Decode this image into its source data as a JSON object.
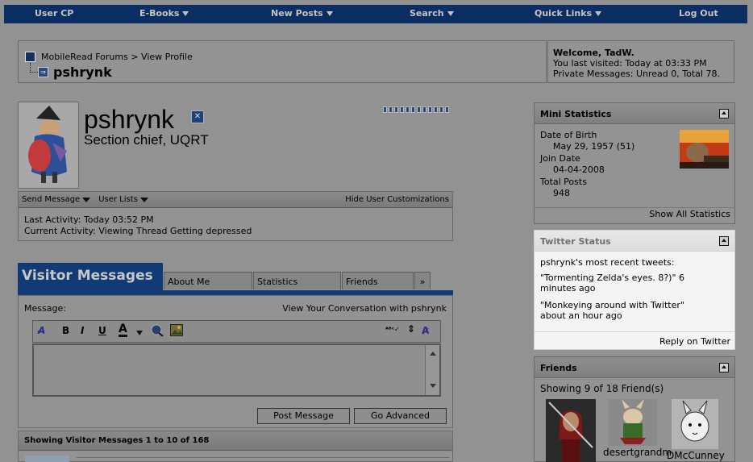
{
  "nav": {
    "items": [
      {
        "label": "User CP",
        "dropdown": false
      },
      {
        "label": "E-Books",
        "dropdown": true
      },
      {
        "label": "New Posts",
        "dropdown": true
      },
      {
        "label": "Search",
        "dropdown": true
      },
      {
        "label": "Quick Links",
        "dropdown": true
      },
      {
        "label": "Log Out",
        "dropdown": false
      }
    ]
  },
  "breadcrumb": {
    "site": "MobileRead Forums",
    "separator": ">",
    "current": "View Profile",
    "page_title": "pshrynk"
  },
  "welcome": {
    "greeting": "Welcome, TadW.",
    "last_visited": "You last visited: Today at 03:33 PM",
    "private_messages": "Private Messages: Unread 0, Total 78."
  },
  "profile": {
    "username": "pshrynk",
    "user_title": "Section chief, UQRT",
    "reputation_pips": 12
  },
  "activity_bar": {
    "send_message": "Send Message",
    "user_lists": "User Lists",
    "hide_customizations": "Hide User Customizations"
  },
  "activity": {
    "last_activity_label": "Last Activity:",
    "last_activity_value": "Today 03:52 PM",
    "current_activity_label": "Current Activity:",
    "current_activity_value": "Viewing Thread Getting depressed"
  },
  "tabs": {
    "active": "Visitor Messages",
    "items": [
      "About Me",
      "Statistics",
      "Friends",
      "»"
    ]
  },
  "message_form": {
    "label": "Message:",
    "conversation_link": "View Your Conversation with pshrynk",
    "post_button": "Post Message",
    "advanced_button": "Go Advanced"
  },
  "visitor_messages_bar": "Showing Visitor Messages 1 to 10 of 168",
  "mini_stats": {
    "title": "Mini Statistics",
    "dob_label": "Date of Birth",
    "dob_value": "May 29, 1957 (51)",
    "join_label": "Join Date",
    "join_value": "04-04-2008",
    "posts_label": "Total Posts",
    "posts_value": "948",
    "show_all": "Show All Statistics"
  },
  "twitter": {
    "title": "Twitter Status",
    "intro": "pshrynk's most recent tweets:",
    "tweets": [
      {
        "text": "\"Tormenting Zelda's eyes. 8?)\"",
        "time_a": "6",
        "time_b": "minutes ago"
      },
      {
        "text": "\"Monkeying around with Twitter\"",
        "time_a": "about an hour ago"
      }
    ],
    "reply": "Reply on Twitter"
  },
  "friends": {
    "title": "Friends",
    "showing": "Showing 9 of 18 Friend(s)",
    "names": [
      "",
      "desertgrandm",
      "DMcCunney"
    ]
  }
}
